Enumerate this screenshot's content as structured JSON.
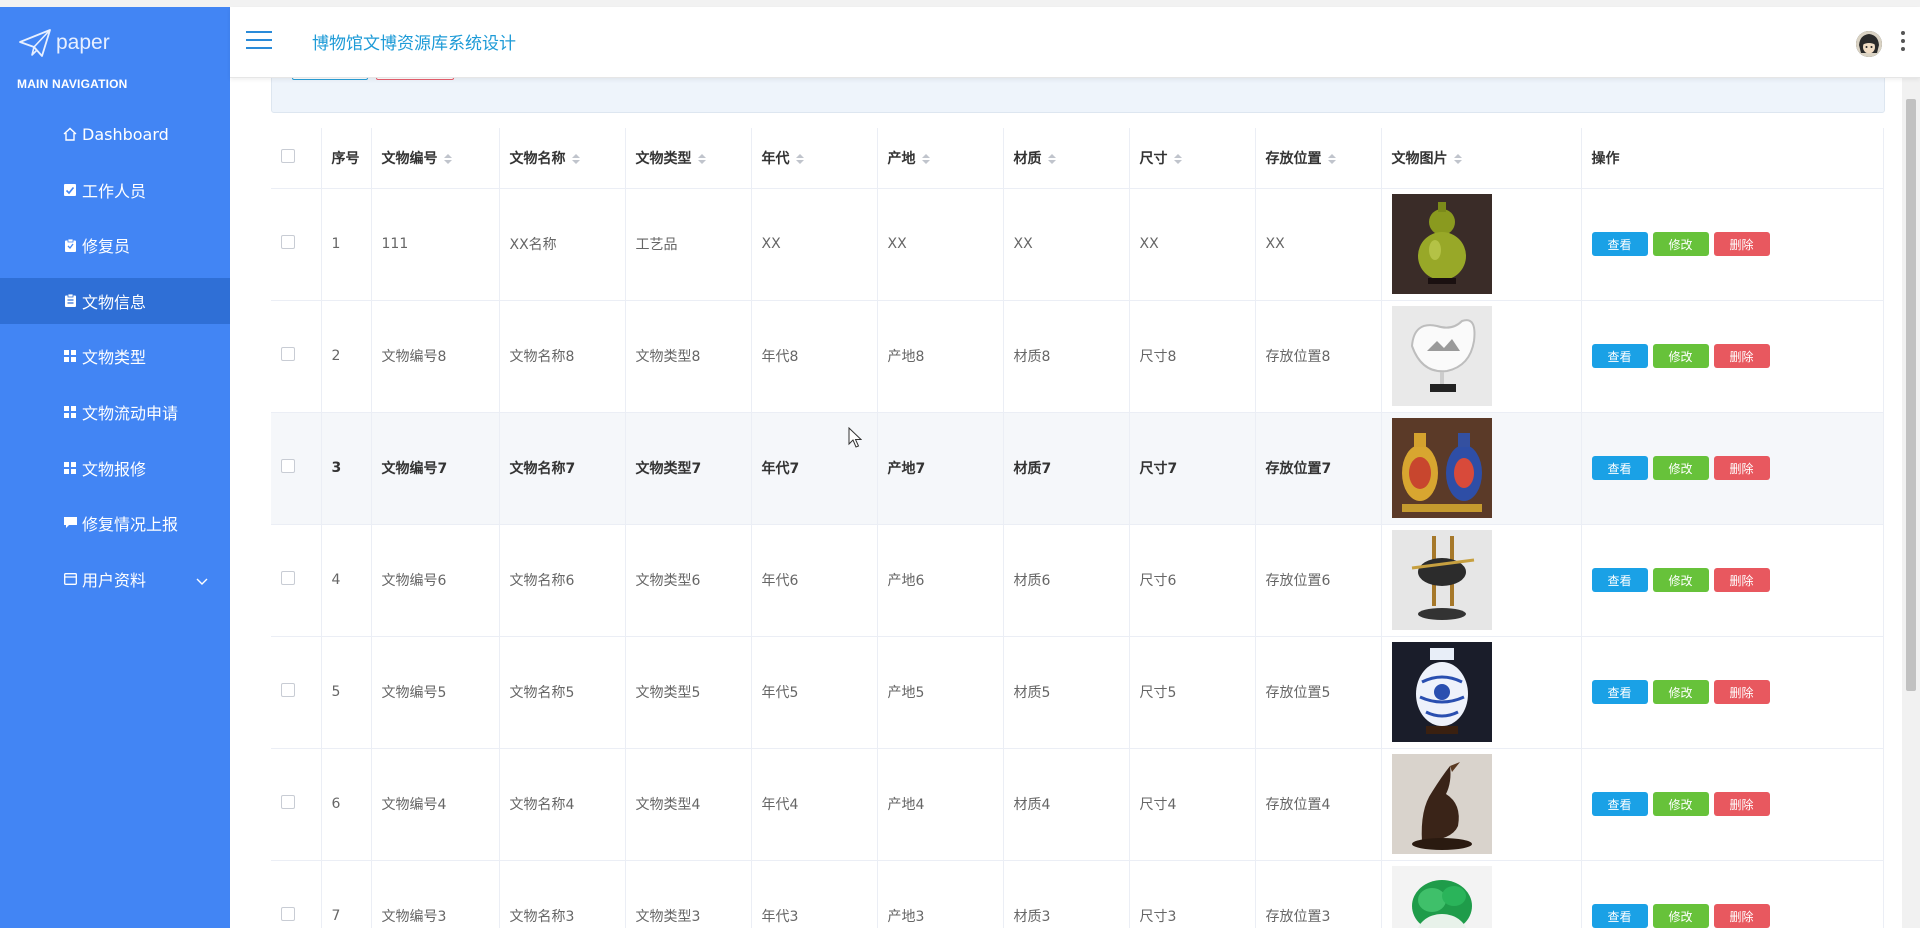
{
  "brand": {
    "name": "paper"
  },
  "sidebar": {
    "section_title": "MAIN NAVIGATION",
    "items": [
      {
        "label": "Dashboard",
        "icon": "home-icon"
      },
      {
        "label": "工作人员",
        "icon": "checkbox-icon"
      },
      {
        "label": "修复员",
        "icon": "clipboard-icon"
      },
      {
        "label": "文物信息",
        "icon": "clipboard-icon",
        "active": true
      },
      {
        "label": "文物类型",
        "icon": "grid-icon"
      },
      {
        "label": "文物流动申请",
        "icon": "grid-icon"
      },
      {
        "label": "文物报修",
        "icon": "grid-icon"
      },
      {
        "label": "修复情况上报",
        "icon": "comment-icon"
      },
      {
        "label": "用户资料",
        "icon": "calendar-icon",
        "expandable": true
      }
    ]
  },
  "header": {
    "title": "博物馆文博资源库系统设计"
  },
  "table": {
    "columns": [
      "序号",
      "文物编号",
      "文物名称",
      "文物类型",
      "年代",
      "产地",
      "材质",
      "尺寸",
      "存放位置",
      "文物图片",
      "操作"
    ],
    "actions": {
      "view": "查看",
      "edit": "修改",
      "delete": "删除"
    },
    "rows": [
      {
        "index": "1",
        "code": "111",
        "name": "XX名称",
        "type": "工艺品",
        "era": "XX",
        "origin": "XX",
        "material": "XX",
        "size": "XX",
        "location": "XX",
        "image": "green-gourd-vase"
      },
      {
        "index": "2",
        "code": "文物编号8",
        "name": "文物名称8",
        "type": "文物类型8",
        "era": "年代8",
        "origin": "产地8",
        "material": "材质8",
        "size": "尺寸8",
        "location": "存放位置8",
        "image": "white-sculpture"
      },
      {
        "index": "3",
        "code": "文物编号7",
        "name": "文物名称7",
        "type": "文物类型7",
        "era": "年代7",
        "origin": "产地7",
        "material": "材质7",
        "size": "尺寸7",
        "location": "存放位置7",
        "image": "cloisonne-vases"
      },
      {
        "index": "4",
        "code": "文物编号6",
        "name": "文物名称6",
        "type": "文物类型6",
        "era": "年代6",
        "origin": "产地6",
        "material": "材质6",
        "size": "尺寸6",
        "location": "存放位置6",
        "image": "bronze-ornament"
      },
      {
        "index": "5",
        "code": "文物编号5",
        "name": "文物名称5",
        "type": "文物类型5",
        "era": "年代5",
        "origin": "产地5",
        "material": "材质5",
        "size": "尺寸5",
        "location": "存放位置5",
        "image": "blue-white-vase"
      },
      {
        "index": "6",
        "code": "文物编号4",
        "name": "文物名称4",
        "type": "文物类型4",
        "era": "年代4",
        "origin": "产地4",
        "material": "材质4",
        "size": "尺寸4",
        "location": "存放位置4",
        "image": "bird-carving"
      },
      {
        "index": "7",
        "code": "文物编号3",
        "name": "文物名称3",
        "type": "文物类型3",
        "era": "年代3",
        "origin": "产地3",
        "material": "材质3",
        "size": "尺寸3",
        "location": "存放位置3",
        "image": "jade-cabbage"
      }
    ]
  }
}
